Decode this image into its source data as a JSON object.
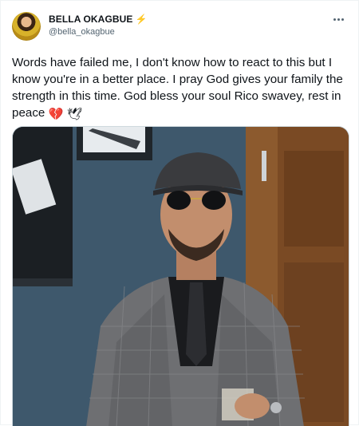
{
  "tweet": {
    "display_name": "BELLA OKAGBUE",
    "name_emoji": "⚡",
    "handle": "@bella_okagbue",
    "text": "Words have failed me, I don't know how to react to this but I know you're in a better place. I pray God gives your family the strength in this time. God bless your soul Rico swavey, rest in peace",
    "emojis": [
      "💔",
      "🕊"
    ]
  },
  "icons": {
    "avatar": "profile-avatar",
    "verified_like": "lightning-bolt-icon",
    "more": "more-options-icon",
    "media": "photo-of-man-in-plaid-suit"
  },
  "colors": {
    "text_primary": "#0f1419",
    "text_secondary": "#536471",
    "bolt": "#f5b301",
    "border": "#cfd9de"
  }
}
